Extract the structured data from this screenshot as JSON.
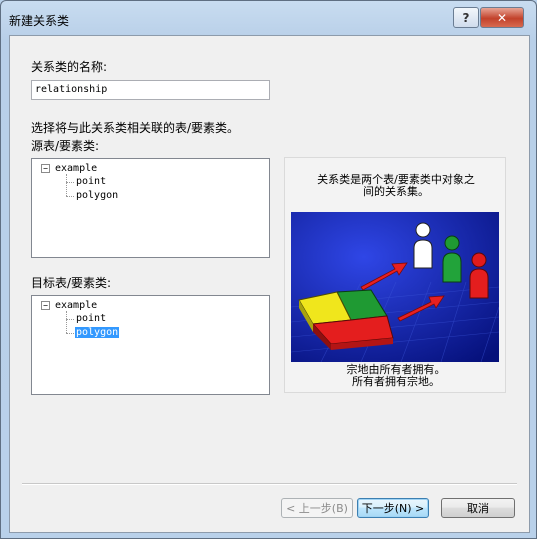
{
  "window": {
    "title": "新建关系类",
    "help_glyph": "?",
    "close_glyph": "✕"
  },
  "name_section": {
    "label": "关系类的名称:",
    "value": "relationship"
  },
  "instruction": "选择将与此关系类相关联的表/要素类。",
  "source": {
    "label": "源表/要素类:",
    "root": "example",
    "children": [
      "point",
      "polygon"
    ]
  },
  "destination": {
    "label": "目标表/要素类:",
    "root": "example",
    "children": [
      "point",
      "polygon"
    ],
    "selected": "polygon"
  },
  "info": {
    "heading": [
      "关系类是两个表/要素类中对象之",
      "间的关系集。"
    ],
    "caption": [
      "宗地由所有者拥有。",
      "所有者拥有宗地。"
    ]
  },
  "buttons": {
    "back": "< 上一步(B)",
    "next": "下一步(N) >",
    "cancel": "取消"
  },
  "colors": {
    "selection": "#3399ff",
    "art_background": "#0c1aa8",
    "arrow": "#e82020"
  }
}
